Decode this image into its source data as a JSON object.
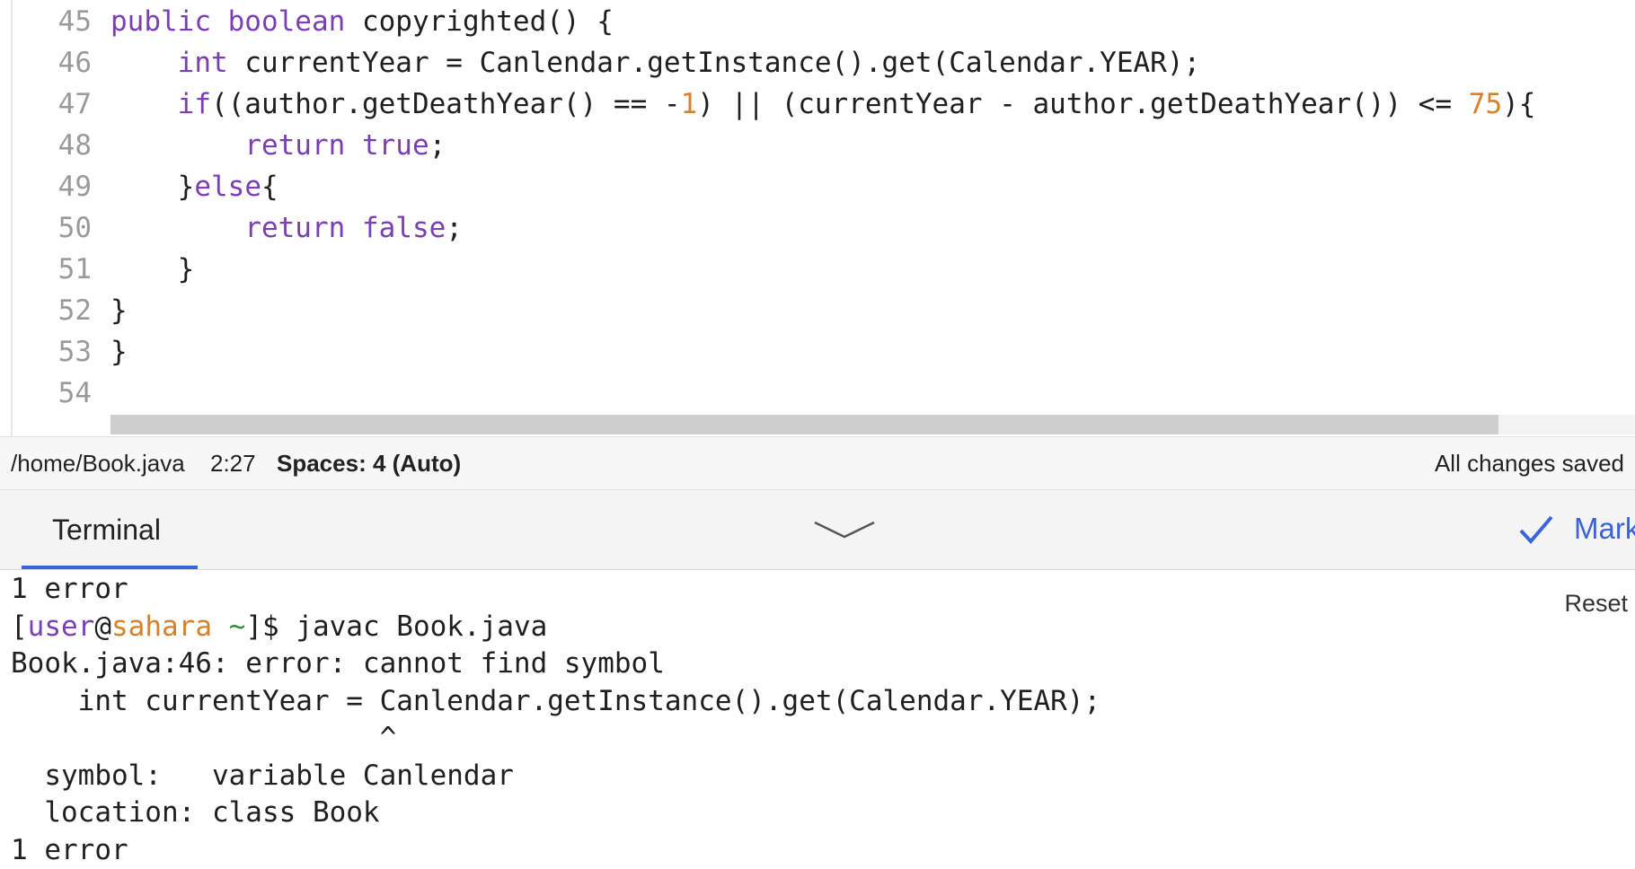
{
  "editor": {
    "lines": [
      {
        "num": "45",
        "segments": [
          {
            "t": "public boolean",
            "c": "kw"
          },
          {
            "t": " copyrighted() {",
            "c": "plain"
          }
        ]
      },
      {
        "num": "46",
        "segments": [
          {
            "t": "    ",
            "c": "plain"
          },
          {
            "t": "int",
            "c": "kw"
          },
          {
            "t": " currentYear = Canlendar.getInstance().get(Calendar.YEAR);",
            "c": "plain"
          }
        ]
      },
      {
        "num": "47",
        "segments": [
          {
            "t": "    ",
            "c": "plain"
          },
          {
            "t": "if",
            "c": "kw"
          },
          {
            "t": "((author.getDeathYear() == -",
            "c": "plain"
          },
          {
            "t": "1",
            "c": "num"
          },
          {
            "t": ") || (currentYear - author.getDeathYear()) <= ",
            "c": "plain"
          },
          {
            "t": "75",
            "c": "num"
          },
          {
            "t": "){",
            "c": "plain"
          }
        ]
      },
      {
        "num": "48",
        "segments": [
          {
            "t": "        ",
            "c": "plain"
          },
          {
            "t": "return true",
            "c": "kw"
          },
          {
            "t": ";",
            "c": "plain"
          }
        ]
      },
      {
        "num": "49",
        "segments": [
          {
            "t": "    }",
            "c": "plain"
          },
          {
            "t": "else",
            "c": "kw"
          },
          {
            "t": "{",
            "c": "plain"
          }
        ]
      },
      {
        "num": "50",
        "segments": [
          {
            "t": "        ",
            "c": "plain"
          },
          {
            "t": "return false",
            "c": "kw"
          },
          {
            "t": ";",
            "c": "plain"
          }
        ]
      },
      {
        "num": "51",
        "segments": [
          {
            "t": "    }",
            "c": "plain"
          }
        ]
      },
      {
        "num": "52",
        "segments": [
          {
            "t": "}",
            "c": "plain"
          }
        ]
      },
      {
        "num": "53",
        "segments": [
          {
            "t": "}",
            "c": "plain"
          }
        ]
      },
      {
        "num": "54",
        "segments": []
      }
    ]
  },
  "status_bar": {
    "path": "/home/Book.java",
    "cursor": "2:27",
    "spaces": "Spaces: 4 (Auto)",
    "saved": "All changes saved"
  },
  "terminal_header": {
    "tab_label": "Terminal",
    "mark_label": "Mark",
    "collapse_icon": "chevron-down-icon",
    "mark_icon": "checkmark-icon"
  },
  "terminal": {
    "reset_label": "Reset",
    "lines": [
      {
        "segments": [
          {
            "t": "1 error",
            "c": "plain"
          }
        ]
      },
      {
        "segments": [
          {
            "t": "[",
            "c": "plain"
          },
          {
            "t": "user",
            "c": "t-user"
          },
          {
            "t": "@",
            "c": "plain"
          },
          {
            "t": "sahara",
            "c": "t-host"
          },
          {
            "t": " ",
            "c": "plain"
          },
          {
            "t": "~",
            "c": "t-tilde"
          },
          {
            "t": "]$ javac Book.java",
            "c": "plain"
          }
        ]
      },
      {
        "segments": [
          {
            "t": "Book.java:46: error: cannot find symbol",
            "c": "plain"
          }
        ]
      },
      {
        "segments": [
          {
            "t": "    int currentYear = Canlendar.getInstance().get(Calendar.YEAR);",
            "c": "plain"
          }
        ]
      },
      {
        "segments": [
          {
            "t": "                      ^",
            "c": "plain"
          }
        ]
      },
      {
        "segments": [
          {
            "t": "  symbol:   variable Canlendar",
            "c": "plain"
          }
        ]
      },
      {
        "segments": [
          {
            "t": "  location: class Book",
            "c": "plain"
          }
        ]
      },
      {
        "segments": [
          {
            "t": "1 error",
            "c": "plain"
          }
        ]
      }
    ]
  },
  "colors": {
    "keyword": "#7b3fb4",
    "number": "#d6822a",
    "accent": "#3a64d8",
    "tilde": "#3a8a3a"
  }
}
